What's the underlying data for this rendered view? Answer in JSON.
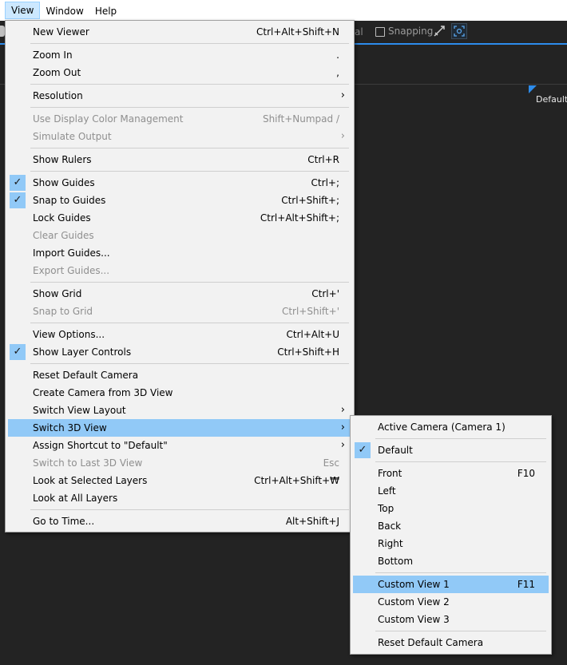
{
  "menubar": {
    "view": "View",
    "window": "Window",
    "help": "Help"
  },
  "toolbar": {
    "fragment": "al",
    "snapping": "Snapping"
  },
  "viewer": {
    "camera_badge": "Default"
  },
  "colors": {
    "highlight": "#91c9f7",
    "menu_bg": "#f2f2f2",
    "app_bg": "#232323",
    "accent": "#2d8ceb"
  },
  "view_menu": {
    "new_viewer": {
      "label": "New Viewer",
      "shortcut": "Ctrl+Alt+Shift+N"
    },
    "zoom_in": {
      "label": "Zoom In",
      "shortcut": "."
    },
    "zoom_out": {
      "label": "Zoom Out",
      "shortcut": ","
    },
    "resolution": {
      "label": "Resolution",
      "arrow": "›"
    },
    "use_display_color": {
      "label": "Use Display Color Management",
      "shortcut": "Shift+Numpad /"
    },
    "simulate_output": {
      "label": "Simulate Output",
      "arrow": "›"
    },
    "show_rulers": {
      "label": "Show Rulers",
      "shortcut": "Ctrl+R"
    },
    "show_guides": {
      "label": "Show Guides",
      "shortcut": "Ctrl+;",
      "checked": true
    },
    "snap_to_guides": {
      "label": "Snap to Guides",
      "shortcut": "Ctrl+Shift+;",
      "checked": true
    },
    "lock_guides": {
      "label": "Lock Guides",
      "shortcut": "Ctrl+Alt+Shift+;"
    },
    "clear_guides": {
      "label": "Clear Guides"
    },
    "import_guides": {
      "label": "Import Guides..."
    },
    "export_guides": {
      "label": "Export Guides..."
    },
    "show_grid": {
      "label": "Show Grid",
      "shortcut": "Ctrl+'"
    },
    "snap_to_grid": {
      "label": "Snap to Grid",
      "shortcut": "Ctrl+Shift+'"
    },
    "view_options": {
      "label": "View Options...",
      "shortcut": "Ctrl+Alt+U"
    },
    "show_layer_controls": {
      "label": "Show Layer Controls",
      "shortcut": "Ctrl+Shift+H",
      "checked": true
    },
    "reset_default_camera": {
      "label": "Reset Default Camera"
    },
    "create_camera": {
      "label": "Create Camera from 3D View"
    },
    "switch_view_layout": {
      "label": "Switch View Layout",
      "arrow": "›"
    },
    "switch_3d_view": {
      "label": "Switch 3D View",
      "arrow": "›"
    },
    "assign_shortcut": {
      "label": "Assign Shortcut to \"Default\"",
      "arrow": "›"
    },
    "switch_to_last": {
      "label": "Switch to Last 3D View",
      "shortcut": "Esc"
    },
    "look_selected": {
      "label": "Look at Selected Layers",
      "shortcut": "Ctrl+Alt+Shift+₩"
    },
    "look_all": {
      "label": "Look at All Layers"
    },
    "go_to_time": {
      "label": "Go to Time...",
      "shortcut": "Alt+Shift+J"
    }
  },
  "switch_3d_submenu": {
    "active_camera": {
      "label": "Active Camera (Camera 1)"
    },
    "default": {
      "label": "Default",
      "checked": true
    },
    "front": {
      "label": "Front",
      "shortcut": "F10"
    },
    "left": {
      "label": "Left"
    },
    "top": {
      "label": "Top"
    },
    "back": {
      "label": "Back"
    },
    "right": {
      "label": "Right"
    },
    "bottom": {
      "label": "Bottom"
    },
    "custom_view_1": {
      "label": "Custom View 1",
      "shortcut": "F11"
    },
    "custom_view_2": {
      "label": "Custom View 2"
    },
    "custom_view_3": {
      "label": "Custom View 3"
    },
    "reset_default_camera": {
      "label": "Reset Default Camera"
    }
  },
  "icons": {
    "check": "✓",
    "target": "◎"
  }
}
